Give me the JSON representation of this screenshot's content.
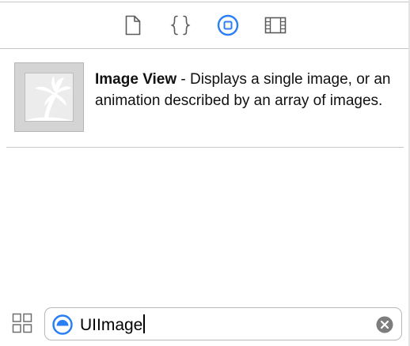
{
  "toolbar": {
    "tabs": [
      {
        "icon": "file-icon",
        "selected": false
      },
      {
        "icon": "code-braces-icon",
        "selected": false
      },
      {
        "icon": "object-library-icon",
        "selected": true
      },
      {
        "icon": "media-library-icon",
        "selected": false
      }
    ]
  },
  "library_item": {
    "icon": "palm-tree-image-icon",
    "title": "Image View",
    "description": " - Displays a single image, or an animation described by an array of images."
  },
  "filter": {
    "view_toggle_icon": "grid-view-icon",
    "scope_icon": "object-scope-icon",
    "value": "UIImage",
    "clear_icon": "clear-icon"
  },
  "colors": {
    "accent": "#2a7ff5",
    "toolbar_icon": "#5b5b5b",
    "divider": "#c6c6c6"
  }
}
